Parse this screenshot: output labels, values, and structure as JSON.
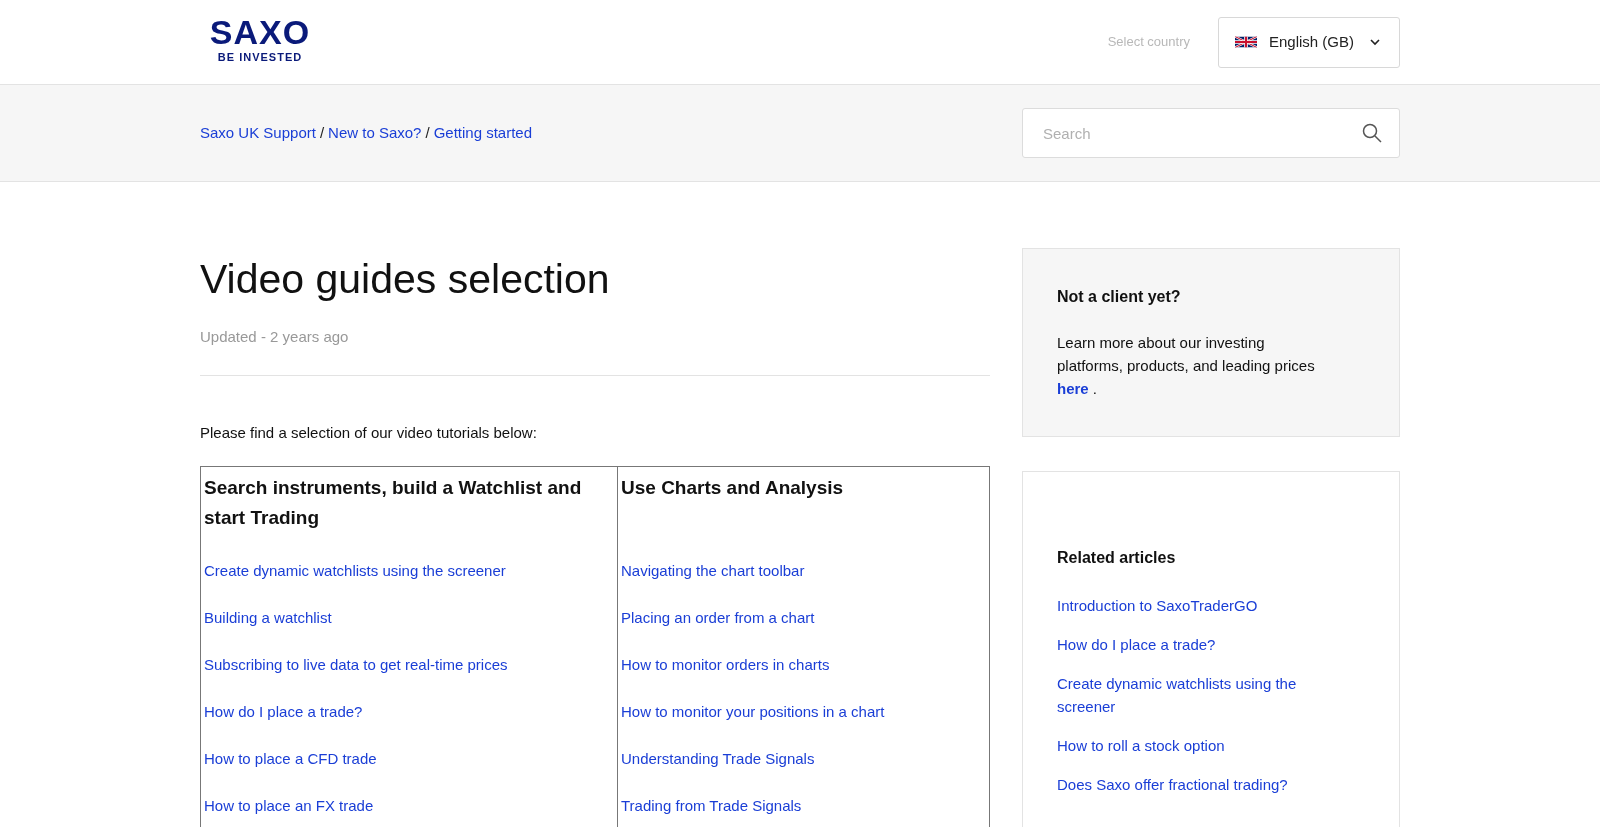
{
  "header": {
    "logo": {
      "wordmark": "SAXO",
      "tagline": "BE INVESTED"
    },
    "country_label": "Select country",
    "language": "English (GB)"
  },
  "breadcrumbs": {
    "separator": "/",
    "items": [
      "Saxo UK Support",
      "New to Saxo?",
      "Getting started"
    ]
  },
  "search": {
    "placeholder": "Search"
  },
  "article": {
    "title": "Video guides selection",
    "meta": "Updated - 2 years ago",
    "intro": "Please find a selection of our video tutorials below:",
    "table": {
      "columns": [
        {
          "heading": "Search instruments, build a Watchlist and start Trading",
          "links": [
            "Create dynamic watchlists using the screener",
            "Building a watchlist",
            "Subscribing to live data to get real-time prices",
            "How do I place a trade?",
            "How to place a CFD trade",
            "How to place an FX trade"
          ]
        },
        {
          "heading": "Use Charts and Analysis",
          "links": [
            "Navigating the chart toolbar",
            "Placing an order from a chart",
            "How to monitor orders in charts",
            "How to monitor your positions in a chart",
            "Understanding Trade Signals",
            "Trading from Trade Signals"
          ]
        }
      ]
    }
  },
  "sidebar": {
    "promo": {
      "title": "Not a client yet?",
      "text": "Learn more about our investing platforms, products, and leading prices",
      "link": "here",
      "after_link": "."
    },
    "related": {
      "title": "Related articles",
      "links": [
        "Introduction to SaxoTraderGO",
        "How do I place a trade?",
        "Create dynamic watchlists using the screener",
        "How to roll a stock option",
        "Does Saxo offer fractional trading?"
      ]
    }
  }
}
